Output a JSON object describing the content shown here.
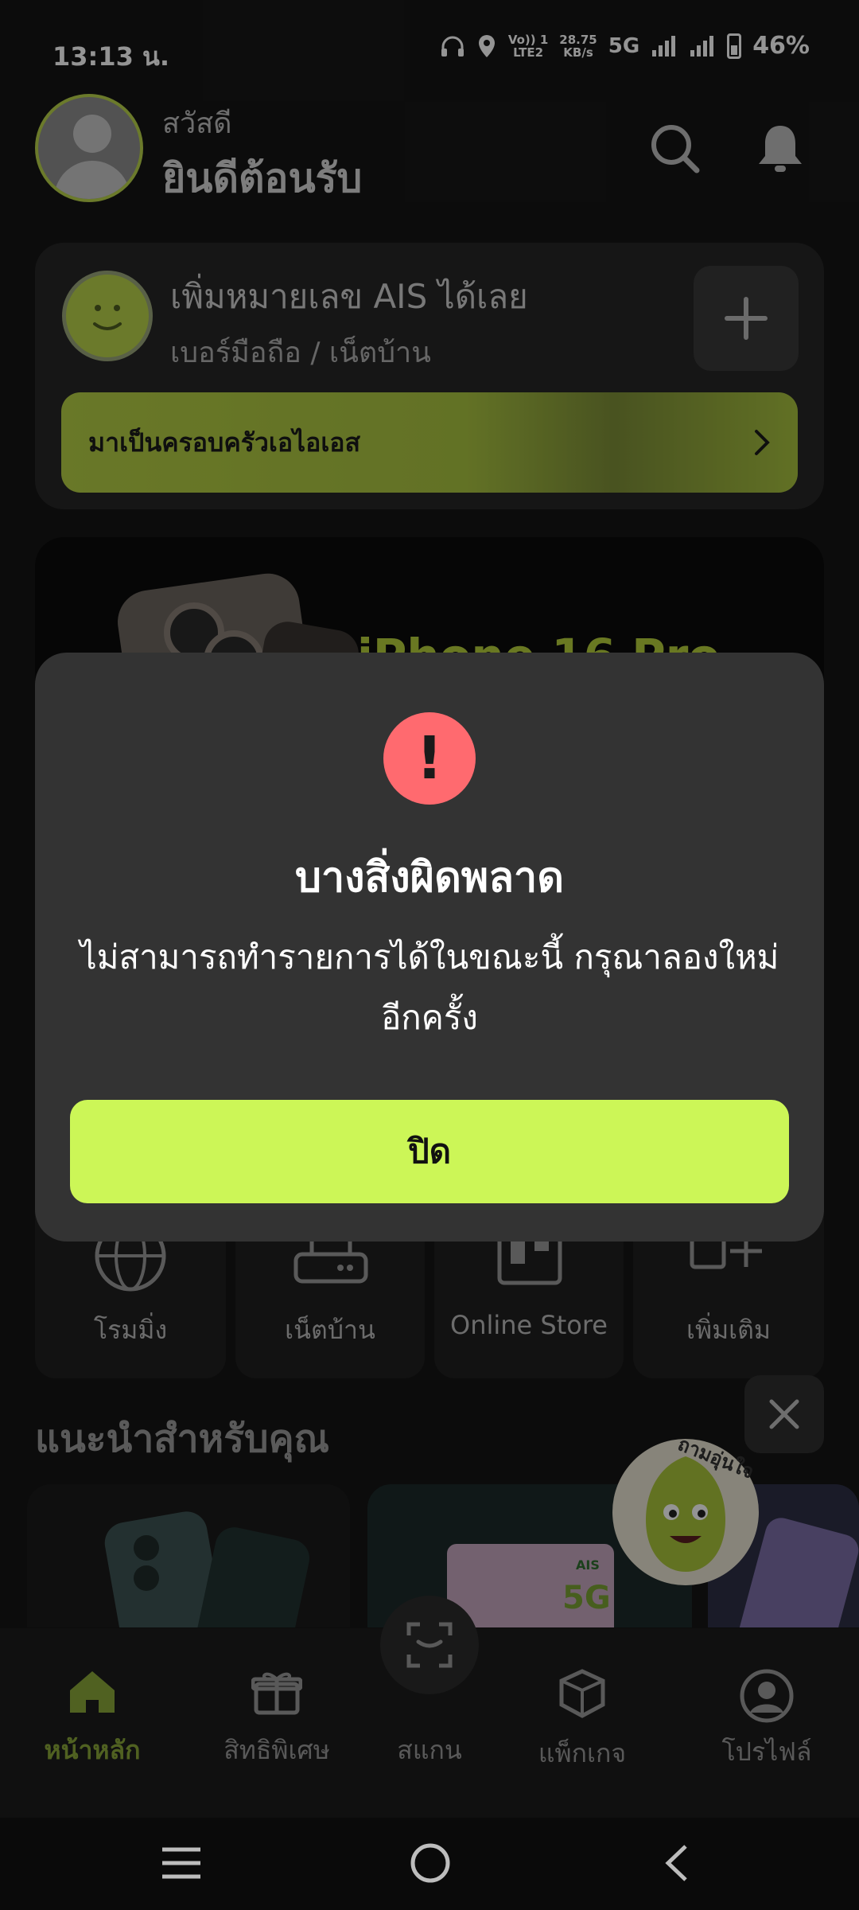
{
  "status_bar": {
    "time": "13:13 น.",
    "volte": "Vo)) 1\nLTE2",
    "speed": "28.75\nKB/s",
    "network": "5G",
    "battery": "46%"
  },
  "header": {
    "greeting": "สวัสดี",
    "welcome": "ยินดีต้อนรับ"
  },
  "add_number": {
    "title": "เพิ่มหมายเลข AIS ได้เลย",
    "subtitle": "เบอร์มือถือ / เน็ตบ้าน",
    "family_link": "มาเป็นครอบครัวเอไอเอส"
  },
  "banner": {
    "text": "iPhone 16 Pro"
  },
  "services": [
    {
      "label": "โรมมิ่ง",
      "icon": "globe-icon"
    },
    {
      "label": "เน็ตบ้าน",
      "icon": "router-icon"
    },
    {
      "label": "Online Store",
      "icon": "store-icon"
    },
    {
      "label": "เพิ่มเติม",
      "icon": "add-more-icon"
    }
  ],
  "recommend": {
    "title": "แนะนำสำหรับคุณ",
    "mascot_label": "ถามอุ่นใจ",
    "sim_brand": "AIS",
    "sim_badge": "5G"
  },
  "bottom_nav": [
    {
      "label": "หน้าหลัก",
      "icon": "home-icon",
      "active": true
    },
    {
      "label": "สิทธิพิเศษ",
      "icon": "gift-icon",
      "active": false
    },
    {
      "label": "สแกน",
      "icon": "scan-icon",
      "active": false
    },
    {
      "label": "แพ็กเกจ",
      "icon": "package-icon",
      "active": false
    },
    {
      "label": "โปรไฟล์",
      "icon": "profile-icon",
      "active": false
    }
  ],
  "dialog": {
    "title": "บางสิ่งผิดพลาด",
    "message": "ไม่สามารถทำรายการได้ในขณะนี้ กรุณาลองใหม่อีกครั้ง",
    "button": "ปิด",
    "icon_glyph": "!"
  },
  "colors": {
    "accent": "#ccf657",
    "active_nav": "#8aa83a",
    "error": "#ff6a6f",
    "modal_bg": "#333333"
  }
}
